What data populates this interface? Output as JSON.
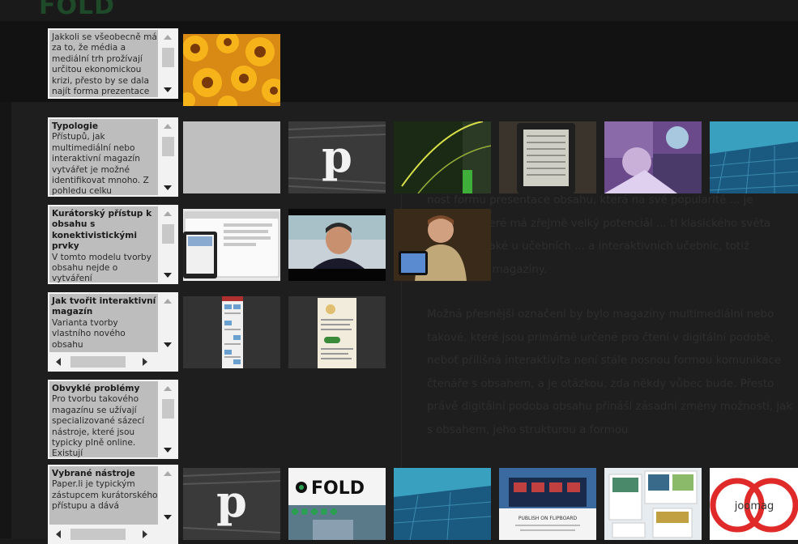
{
  "background": {
    "logo": "FOLD",
    "article_paragraphs": [
      "nost formu presentace obsahu, která na své popularitě ... je médium, které má zřejmě velký potenciál ... ti klasického světa médií, tak také u učebních ... a interaktivních učebnic, totiž interaktivní magazíny.",
      "Možná přesnější označení by bylo magazíny multimediální nebo takové, které jsou primárně určené pro čtení v digitální podobě, neboť přílišná interaktivita není stále nosnou formou komunikace čtenáře s obsahem, a je otázkou, zda někdy vůbec bude. Přesto právě digitální podoba obsahu přináší zásadní změny možností, jak s obsahem, jeho strukturou a formou"
    ]
  },
  "cards": [
    {
      "title": "",
      "text": "Jakkoli se všeobecně má za to, že média a mediální trh prožívají určitou ekonomickou krizi, přesto by se dala najít forma prezentace obsahu"
    },
    {
      "title": "Typologie",
      "text": "Přístupů, jak multimediální nebo interaktivní magazín vytvářet je možné identifikovat mnoho. Z pohledu celku"
    },
    {
      "title": "Kurátorský přístup k obsahu s konektivistickými prvky",
      "text": "V tomto modelu tvorby obsahu nejde o vytváření"
    },
    {
      "title": "Jak tvořit interaktivní magazín",
      "text": "Varianta tvorby vlastního nového obsahu"
    },
    {
      "title": "Obvyklé problémy",
      "text": "Pro tvorbu takového magazínu se užívají specializované sázecí nástroje, které jsou typicky plně online. Existují"
    },
    {
      "title": "Vybrané nástroje",
      "text": "Paper.li je typickým zástupcem kurátorského přístupu a dává"
    }
  ],
  "thumbnails": {
    "fold_logo": "FOLD",
    "joomag_logo": "joomag",
    "paperli_letter": "p",
    "flipboard_caption": "PUBLISH ON FLIPBOARD"
  }
}
